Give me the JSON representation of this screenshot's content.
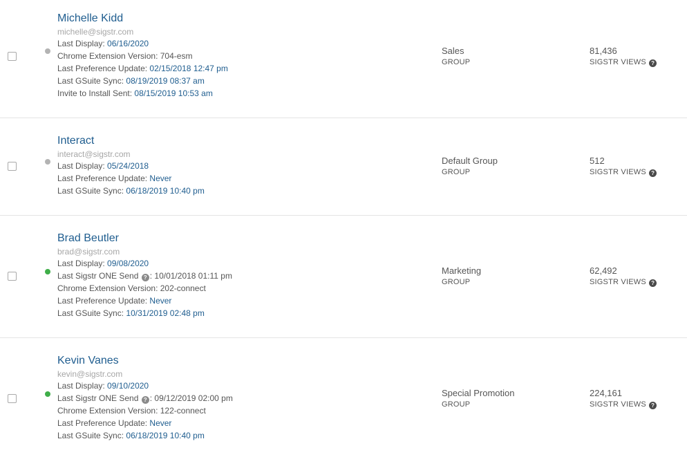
{
  "colors": {
    "link": "#1f5d8f",
    "muted": "#a6a6a6",
    "text": "#555555",
    "active_dot": "#3fae49",
    "inactive_dot": "#b3b3b3"
  },
  "users": [
    {
      "name": "Michelle Kidd",
      "email": "michelle@sigstr.com",
      "status": "inactive",
      "details": {
        "last_display_label": "Last Display:",
        "last_display": "06/16/2020",
        "chrome_ext_label": "Chrome Extension Version:",
        "chrome_ext": "704-esm",
        "last_pref_label": "Last Preference Update:",
        "last_pref": "02/15/2018 12:47 pm",
        "last_gsuite_label": "Last GSuite Sync:",
        "last_gsuite": "08/19/2019 08:37 am",
        "invite_label": "Invite to Install Sent:",
        "invite": "08/15/2019 10:53 am"
      },
      "group": "Sales",
      "group_label": "GROUP",
      "views": "81,436",
      "views_label": "SIGSTR VIEWS"
    },
    {
      "name": "Interact",
      "email": "interact@sigstr.com",
      "status": "inactive",
      "details": {
        "last_display_label": "Last Display:",
        "last_display": "05/24/2018",
        "last_pref_label": "Last Preference Update:",
        "last_pref": "Never",
        "last_gsuite_label": "Last GSuite Sync:",
        "last_gsuite": "06/18/2019 10:40 pm"
      },
      "group": "Default Group",
      "group_label": "GROUP",
      "views": "512",
      "views_label": "SIGSTR VIEWS"
    },
    {
      "name": "Brad Beutler",
      "email": "brad@sigstr.com",
      "status": "active",
      "details": {
        "last_display_label": "Last Display:",
        "last_display": "09/08/2020",
        "one_send_label": "Last Sigstr ONE Send",
        "one_send": "10/01/2018 01:11 pm",
        "chrome_ext_label": "Chrome Extension Version:",
        "chrome_ext": "202-connect",
        "last_pref_label": "Last Preference Update:",
        "last_pref": "Never",
        "last_gsuite_label": "Last GSuite Sync:",
        "last_gsuite": "10/31/2019 02:48 pm"
      },
      "group": "Marketing",
      "group_label": "GROUP",
      "views": "62,492",
      "views_label": "SIGSTR VIEWS"
    },
    {
      "name": "Kevin Vanes",
      "email": "kevin@sigstr.com",
      "status": "active",
      "details": {
        "last_display_label": "Last Display:",
        "last_display": "09/10/2020",
        "one_send_label": "Last Sigstr ONE Send",
        "one_send": "09/12/2019 02:00 pm",
        "chrome_ext_label": "Chrome Extension Version:",
        "chrome_ext": "122-connect",
        "last_pref_label": "Last Preference Update:",
        "last_pref": "Never",
        "last_gsuite_label": "Last GSuite Sync:",
        "last_gsuite": "06/18/2019 10:40 pm"
      },
      "group": "Special Promotion",
      "group_label": "GROUP",
      "views": "224,161",
      "views_label": "SIGSTR VIEWS"
    }
  ]
}
